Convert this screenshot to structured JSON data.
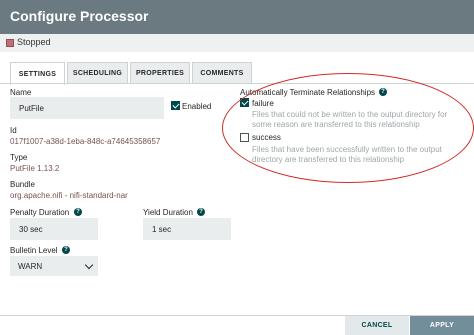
{
  "dialog": {
    "title": "Configure Processor",
    "status": "Stopped"
  },
  "tabs": [
    {
      "label": "SETTINGS"
    },
    {
      "label": "SCHEDULING"
    },
    {
      "label": "PROPERTIES"
    },
    {
      "label": "COMMENTS"
    }
  ],
  "settings": {
    "name_label": "Name",
    "name_value": "PutFile",
    "enabled_label": "Enabled",
    "id_label": "Id",
    "id_value": "017f1007-a38d-1eba-848c-a74645358657",
    "type_label": "Type",
    "type_value": "PutFile 1.13.2",
    "bundle_label": "Bundle",
    "bundle_value": "org.apache.nifi - nifi-standard-nar",
    "penalty_label": "Penalty Duration",
    "penalty_value": "30 sec",
    "yield_label": "Yield Duration",
    "yield_value": "1 sec",
    "bulletin_label": "Bulletin Level",
    "bulletin_value": "WARN"
  },
  "relationships": {
    "heading": "Automatically Terminate Relationships",
    "items": [
      {
        "name": "failure",
        "checked": true,
        "description": "Files that could not be written to the output directory for some reason are transferred to this relationship"
      },
      {
        "name": "success",
        "checked": false,
        "description": "Files that have been successfully written to the output directory are transferred to this relationship"
      }
    ]
  },
  "footer": {
    "cancel": "CANCEL",
    "apply": "APPLY"
  },
  "colors": {
    "titlebar": "#6a7a80",
    "accent": "#004849",
    "value_text": "#775351",
    "annotation_circle": "#d02b2b"
  }
}
